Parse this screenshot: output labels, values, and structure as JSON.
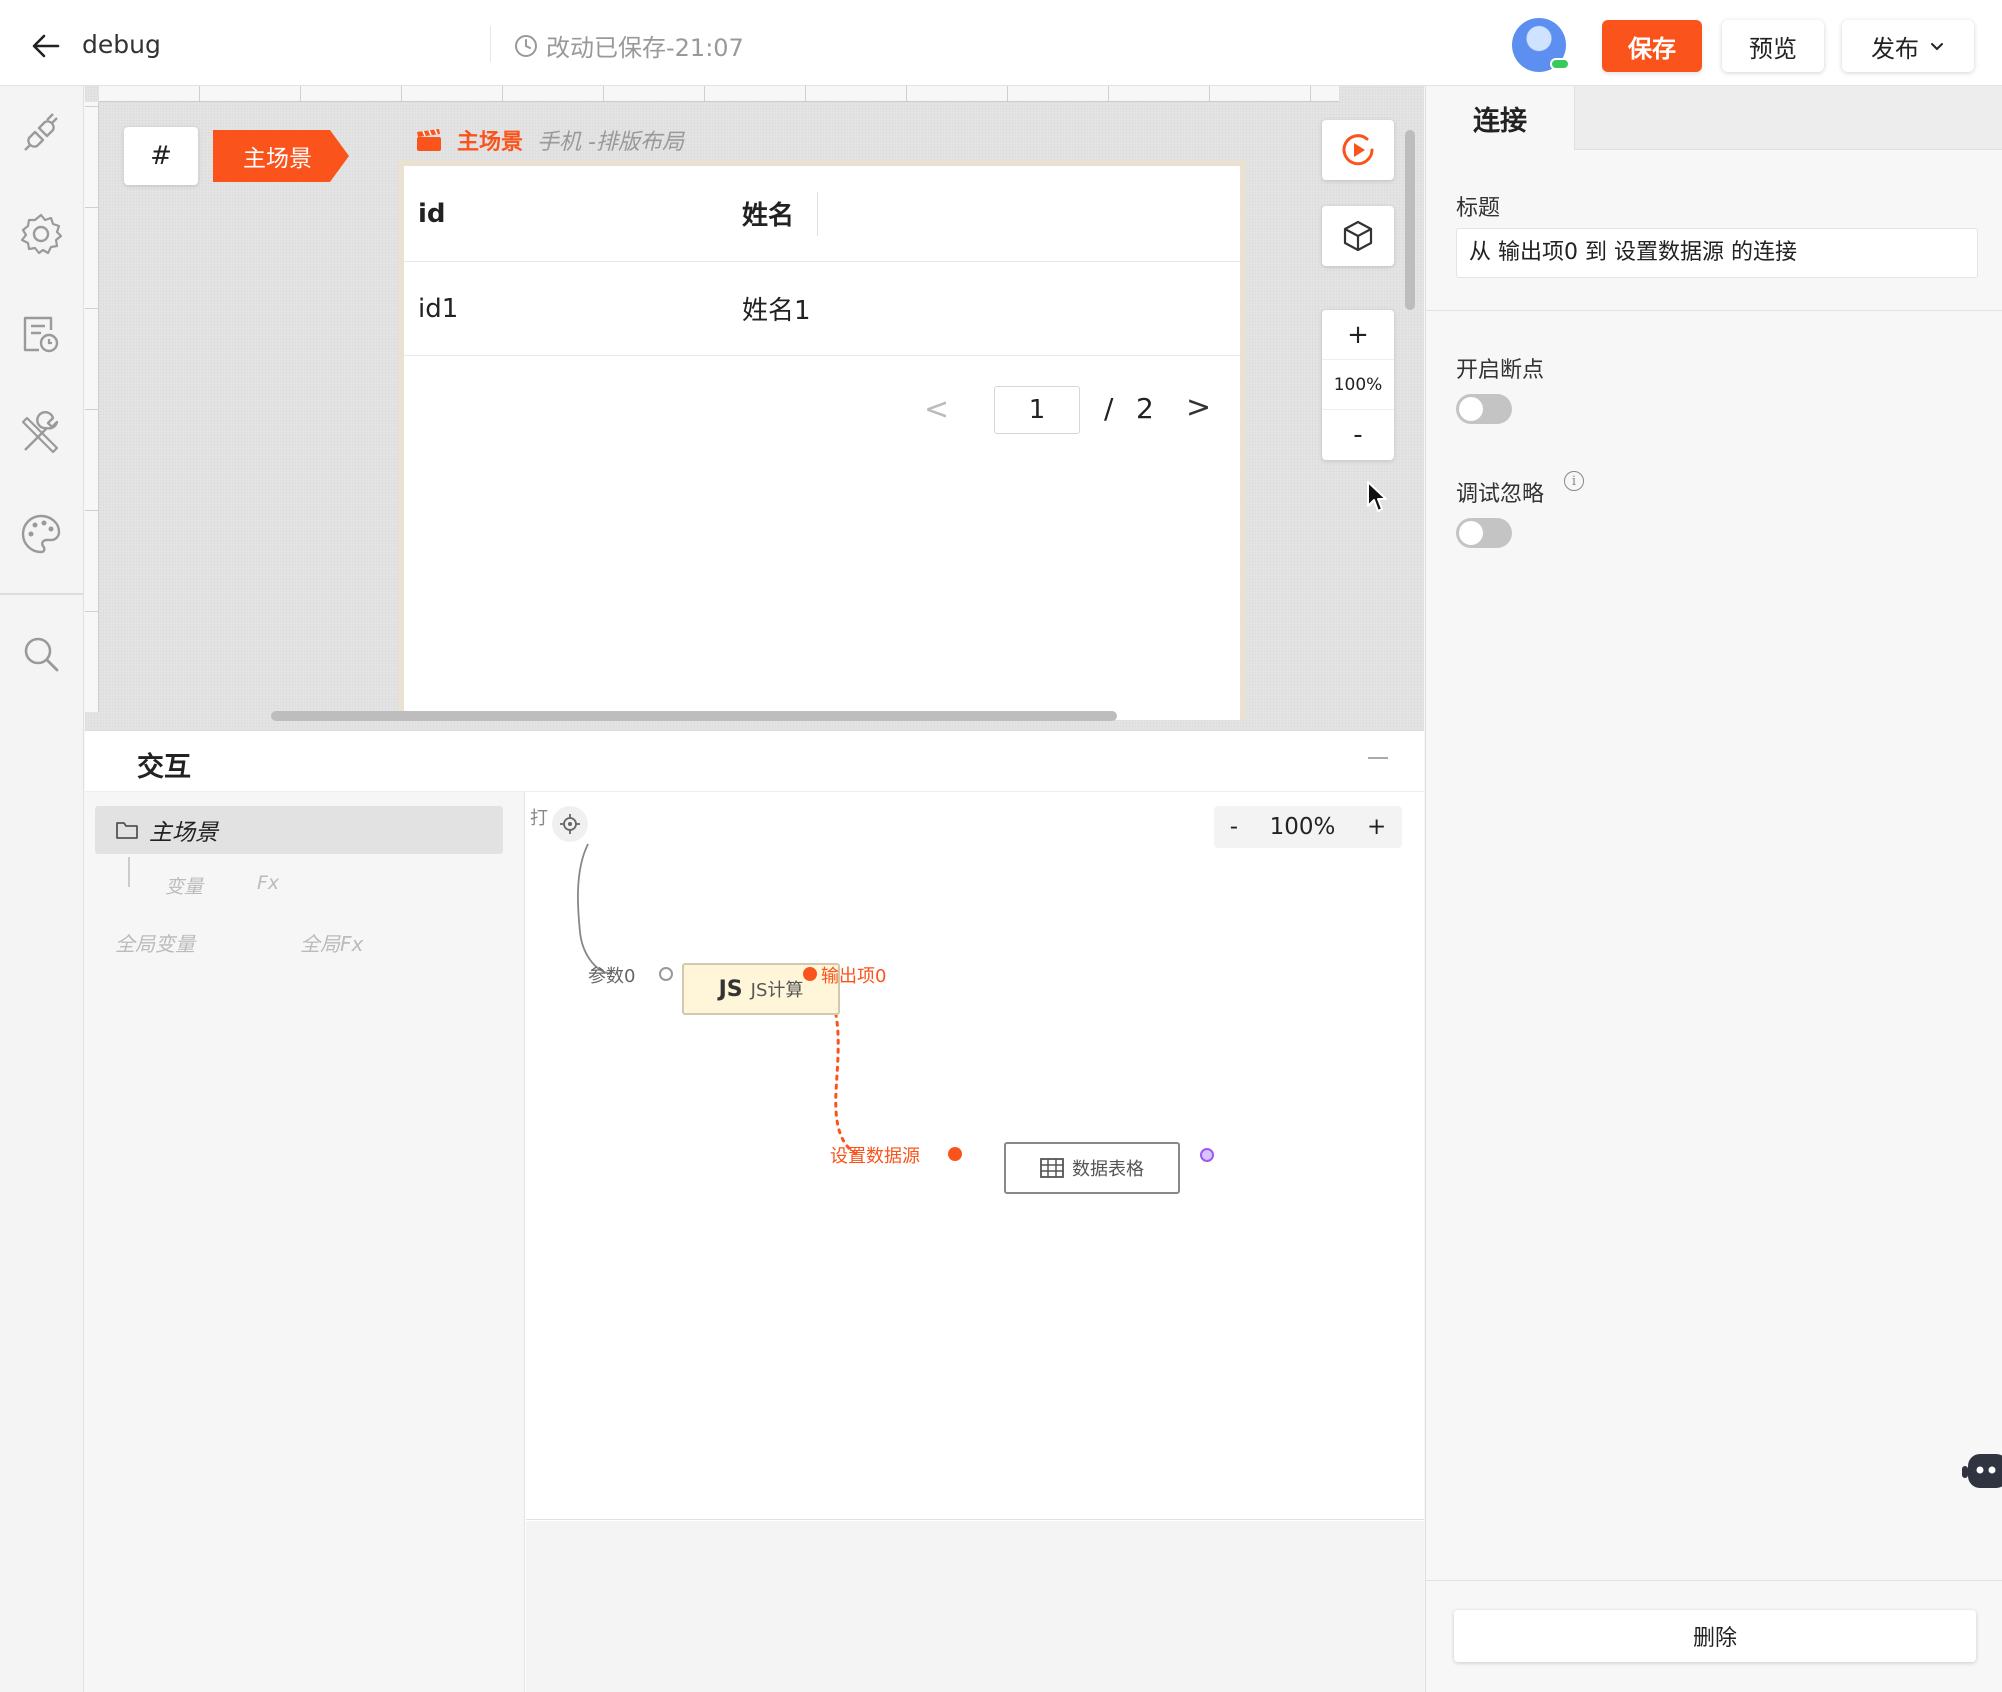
{
  "header": {
    "title": "debug",
    "save_status": "改动已保存-21:07",
    "save_label": "保存",
    "preview_label": "预览",
    "publish_label": "发布"
  },
  "colors": {
    "accent": "#fa541c",
    "toggle_off": "#c4c4c4",
    "link_line": "#fa541c",
    "output_port": "#9b59f6"
  },
  "rail": {
    "icons": [
      "plug-icon",
      "settings-icon",
      "data-file-icon",
      "tools-icon",
      "palette-icon",
      "search-icon"
    ]
  },
  "canvas": {
    "hash_label": "#",
    "scene_tag": "主场景",
    "caption_scene": "主场景",
    "caption_layout": "手机 -排版布局",
    "table": {
      "columns": [
        "id",
        "姓名"
      ],
      "rows": [
        [
          "id1",
          "姓名1"
        ]
      ]
    },
    "pager": {
      "prev": "<",
      "current_page": "1",
      "separator": "/",
      "total_pages": "2",
      "next": ">"
    },
    "zoom": {
      "plus": "+",
      "value": "100%",
      "minus": "-"
    }
  },
  "interaction": {
    "title": "交互",
    "scene_item": "主场景",
    "sub_items": [
      "变量",
      "Fx"
    ],
    "global_items": [
      "全局变量",
      "全局Fx"
    ],
    "flow": {
      "top_label": "打",
      "zoom_minus": "-",
      "zoom_value": "100%",
      "zoom_plus": "+",
      "js_node_prefix": "JS",
      "js_node_label": "JS计算",
      "input_port_label": "参数0",
      "output_port_label": "输出项0",
      "target_port_label": "设置数据源",
      "table_node_label": "数据表格"
    }
  },
  "right_panel": {
    "tab_label": "连接",
    "title_label": "标题",
    "title_value": "从 输出项0 到 设置数据源 的连接",
    "breakpoint_label": "开启断点",
    "breakpoint_on": false,
    "ignore_label": "调试忽略",
    "ignore_on": false,
    "info_glyph": "i",
    "delete_label": "删除"
  }
}
